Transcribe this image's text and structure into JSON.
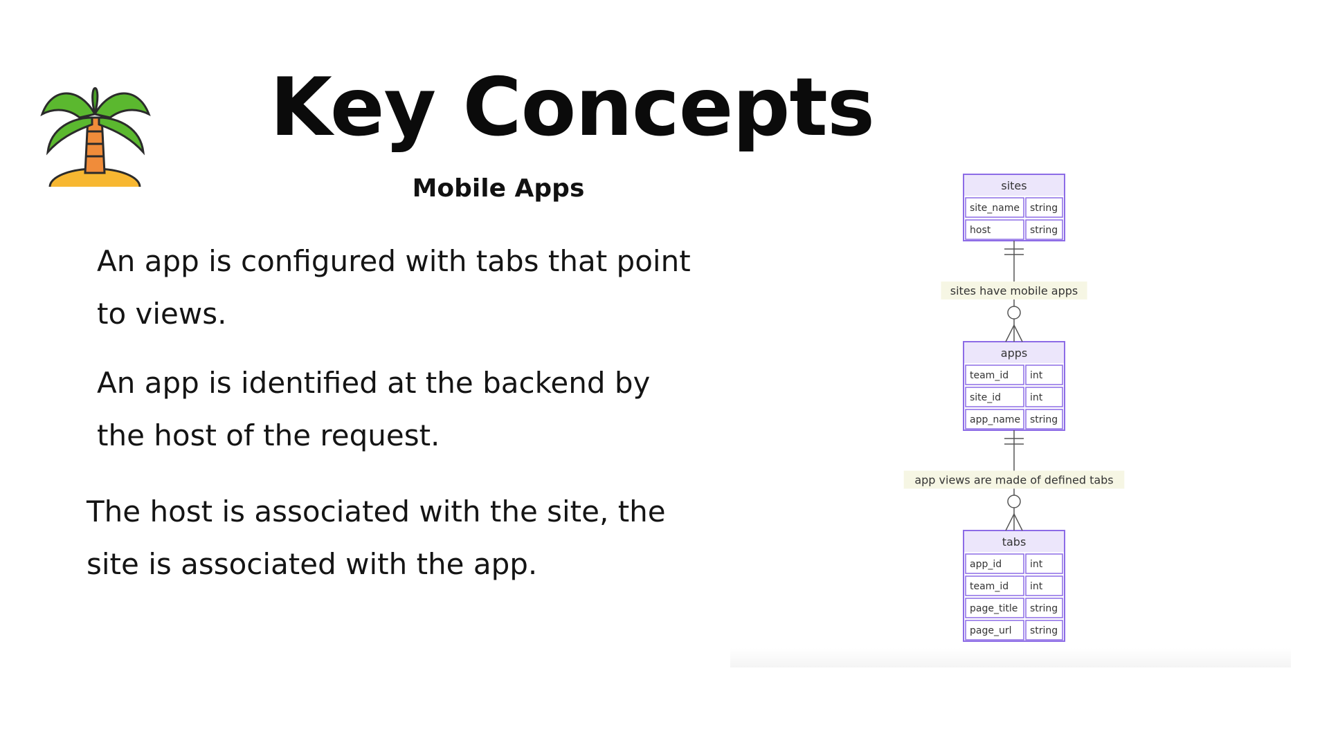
{
  "slide": {
    "title": "Key Concepts",
    "subtitle": "Mobile Apps",
    "paragraphs": [
      "An app is configured with tabs that point to views.",
      "An app is identified at the backend by the host of the request.",
      "The host is associated with the site, the site is associated with the app."
    ]
  },
  "logo": {
    "icon": "palm-tree-island-icon",
    "colors": {
      "leaves": "#5bb82f",
      "trunk": "#f08c3a",
      "sand": "#f7b731"
    }
  },
  "diagram": {
    "colors": {
      "entity_border": "#8c6be6",
      "entity_fill": "#ffffff",
      "header_fill": "#ece6fb",
      "line": "#555555",
      "label_bg": "#f6f6e4"
    },
    "entities": [
      {
        "name": "sites",
        "fields": [
          {
            "name": "site_name",
            "type": "string"
          },
          {
            "name": "host",
            "type": "string"
          }
        ]
      },
      {
        "name": "apps",
        "fields": [
          {
            "name": "team_id",
            "type": "int"
          },
          {
            "name": "site_id",
            "type": "int"
          },
          {
            "name": "app_name",
            "type": "string"
          }
        ]
      },
      {
        "name": "tabs",
        "fields": [
          {
            "name": "app_id",
            "type": "int"
          },
          {
            "name": "team_id",
            "type": "int"
          },
          {
            "name": "page_title",
            "type": "string"
          },
          {
            "name": "page_url",
            "type": "string"
          }
        ]
      }
    ],
    "relationships": [
      {
        "label": "sites have mobile apps",
        "from": "sites",
        "to": "apps",
        "cardinality": "one-to-many"
      },
      {
        "label": "app views are made of defined tabs",
        "from": "apps",
        "to": "tabs",
        "cardinality": "one-to-many"
      }
    ]
  }
}
